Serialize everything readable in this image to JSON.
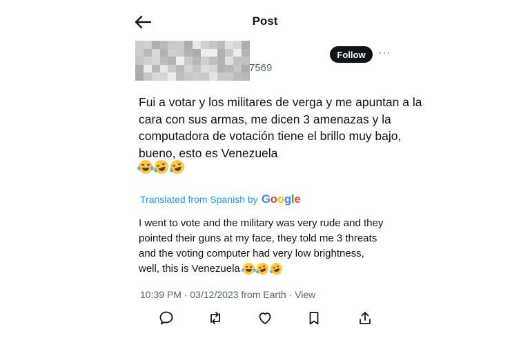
{
  "header": {
    "title": "Post",
    "back_icon": "arrow-left-icon"
  },
  "author": {
    "handle_suffix": "7569",
    "follow_label": "Follow",
    "more_label": "···"
  },
  "post": {
    "text": "Fui a votar y los militares de verga y me apuntan a la cara con sus armas, me dicen 3 amenazas y la computadora de votación tiene el brillo muy bajo, bueno, esto es Venezuela",
    "emojis": [
      "laughing-tears-emoji",
      "rofl-emoji",
      "rofl-emoji"
    ]
  },
  "translation": {
    "label": "Translated from Spanish by",
    "provider": "Google",
    "provider_colors": [
      "#4285F4",
      "#EA4335",
      "#FBBC05",
      "#4285F4",
      "#34A853",
      "#EA4335"
    ],
    "text": "I went to vote and the military was very rude and they pointed their guns at my face, they told me 3 threats and the voting computer had very low brightness, well, this is Venezuela"
  },
  "meta": {
    "time": "10:39 PM",
    "separator": " · ",
    "date": "03/12/2023",
    "location": " from Earth",
    "view_label": "View"
  },
  "actions": [
    "reply-icon",
    "repost-icon",
    "like-icon",
    "bookmark-icon",
    "share-icon"
  ],
  "colors": {
    "accent": "#1d9bf0",
    "text": "#0f1419",
    "muted": "#536471",
    "follow_bg": "#0f1419"
  }
}
